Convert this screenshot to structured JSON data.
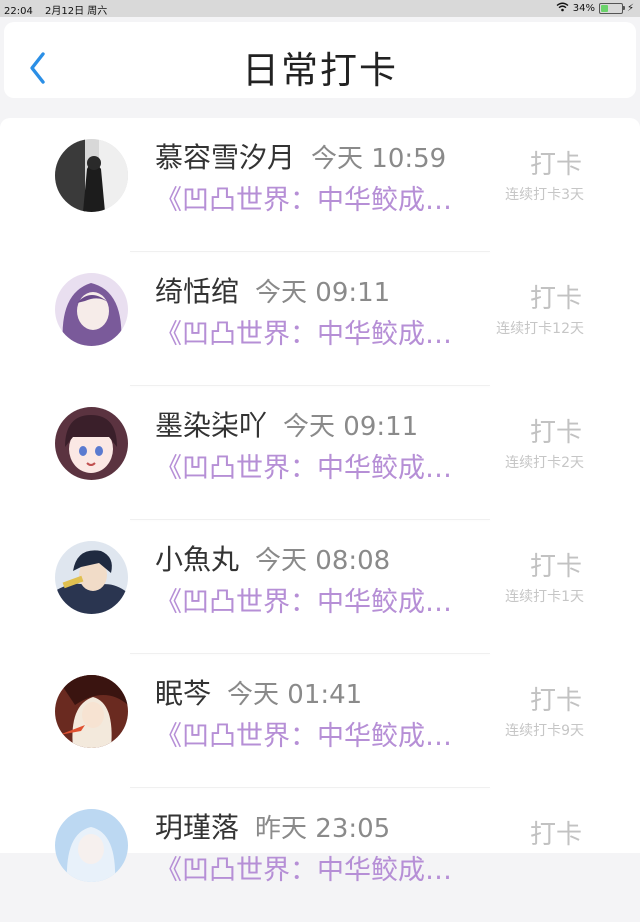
{
  "status_bar": {
    "time": "22:04",
    "date": "2月12日 周六",
    "battery": "34%"
  },
  "header": {
    "title": "日常打卡"
  },
  "items": [
    {
      "name": "慕容雪汐月",
      "time": "今天 10:59",
      "content": "《凹凸世界：中华鲛成…",
      "action": "打卡",
      "streak": "连续打卡3天"
    },
    {
      "name": "绮恬绾",
      "time": "今天 09:11",
      "content": "《凹凸世界：中华鲛成…",
      "action": "打卡",
      "streak": "连续打卡12天"
    },
    {
      "name": "墨染柒吖",
      "time": "今天 09:11",
      "content": "《凹凸世界：中华鲛成…",
      "action": "打卡",
      "streak": "连续打卡2天"
    },
    {
      "name": "小魚丸",
      "time": "今天 08:08",
      "content": "《凹凸世界：中华鲛成…",
      "action": "打卡",
      "streak": "连续打卡1天"
    },
    {
      "name": "眠芩",
      "time": "今天 01:41",
      "content": "《凹凸世界：中华鲛成…",
      "action": "打卡",
      "streak": "连续打卡9天"
    },
    {
      "name": "玥瑾落",
      "time": "昨天 23:05",
      "content": "《凹凸世界：中华鲛成…",
      "action": "打卡",
      "streak": ""
    }
  ],
  "colors": {
    "accent": "#2b8fe6",
    "content_purple": "#b68fd6"
  }
}
